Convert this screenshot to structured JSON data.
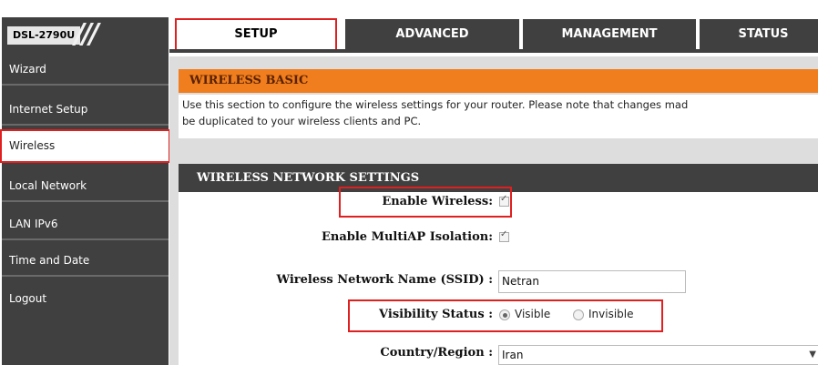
{
  "header": {
    "model": "DSL-2790U",
    "tabs": [
      {
        "label": "SETUP",
        "highlighted": true
      },
      {
        "label": "ADVANCED"
      },
      {
        "label": "MANAGEMENT"
      },
      {
        "label": "STATUS"
      }
    ]
  },
  "sidebar": {
    "items": [
      {
        "label": "Wizard"
      },
      {
        "label": "Internet Setup"
      },
      {
        "label": "Wireless",
        "highlighted": true
      },
      {
        "label": "Local Network"
      },
      {
        "label": "LAN IPv6"
      },
      {
        "label": "Time and Date"
      },
      {
        "label": "Logout"
      }
    ]
  },
  "wireless_basic": {
    "title": "WIRELESS BASIC",
    "description_line1": "Use this section to configure the wireless settings for your router. Please note that changes mad",
    "description_line2": "be duplicated to your wireless clients and PC."
  },
  "network_settings": {
    "title": "WIRELESS NETWORK SETTINGS",
    "enable_wireless_label": "Enable Wireless:",
    "enable_wireless_checked": true,
    "multiap_label": "Enable MultiAP Isolation:",
    "multiap_checked": true,
    "ssid_label": "Wireless Network Name (SSID) :",
    "ssid_value": "Netran",
    "visibility_label": "Visibility Status :",
    "visibility_options": [
      "Visible",
      "Invisible"
    ],
    "visibility_selected": "Visible",
    "country_label": "Country/Region :",
    "country_value": "Iran"
  },
  "colors": {
    "accent_orange": "#f07d1e",
    "dark_bar": "#404040",
    "highlight_red": "#e02020"
  }
}
